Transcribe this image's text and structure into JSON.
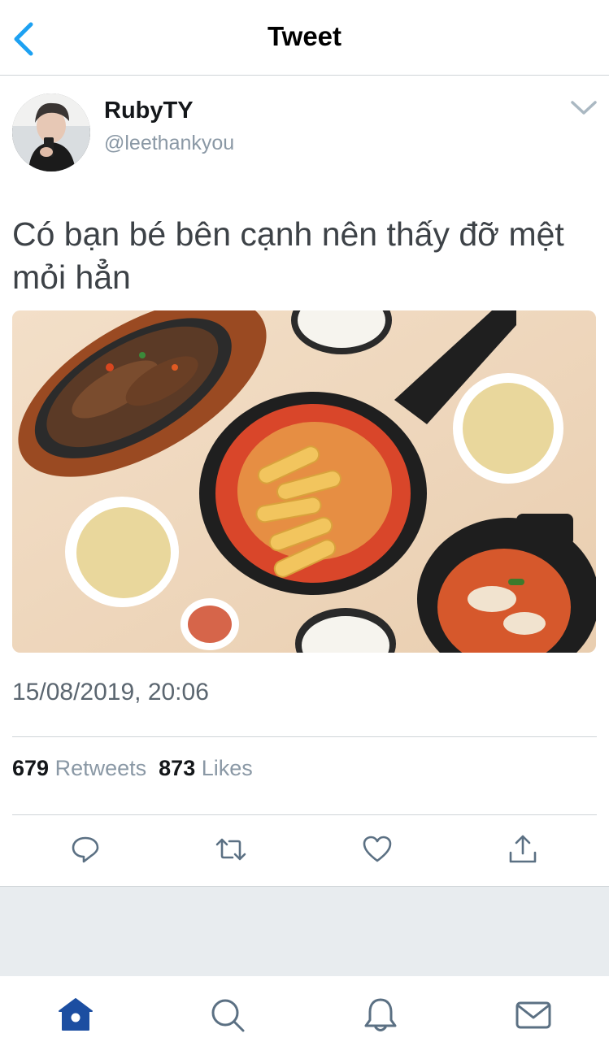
{
  "header": {
    "title": "Tweet",
    "back_icon": "chevron-left-icon"
  },
  "tweet": {
    "display_name": "RubyTY",
    "handle": "@leethankyou",
    "text": "Có bạn bé bên cạnh nên thấy đỡ mệt mỏi hẳn",
    "timestamp": "15/08/2019, 20:06",
    "retweets_count": "679",
    "retweets_label": "Retweets",
    "likes_count": "873",
    "likes_label": "Likes"
  },
  "actions": [
    "reply-icon",
    "retweet-icon",
    "like-icon",
    "share-icon"
  ],
  "tabbar": [
    "home-icon",
    "search-icon",
    "notifications-icon",
    "messages-icon"
  ],
  "colors": {
    "accent": "#1da1f2",
    "tab_active": "#1c4ea1",
    "muted": "#8a98a5",
    "divider": "#cfd4d8"
  }
}
